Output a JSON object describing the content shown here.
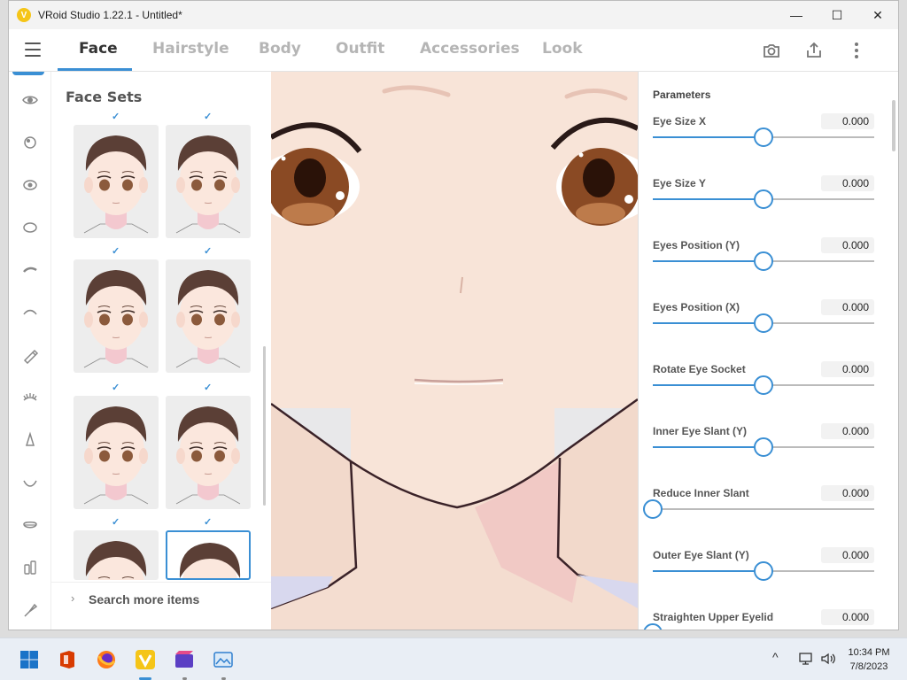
{
  "window": {
    "title": "VRoid Studio 1.22.1 - Untitled*",
    "controls": {
      "minimize": "—",
      "maximize": "☐",
      "close": "✕"
    }
  },
  "tabs": [
    {
      "label": "Face",
      "active": true
    },
    {
      "label": "Hairstyle",
      "active": false
    },
    {
      "label": "Body",
      "active": false
    },
    {
      "label": "Outfit",
      "active": false
    },
    {
      "label": "Accessories",
      "active": false
    },
    {
      "label": "Look",
      "active": false
    }
  ],
  "toolbar_icons": [
    "camera-icon",
    "export-icon",
    "more-vert-icon"
  ],
  "rail_icons": [
    "eye-icon",
    "eye-highlight-icon",
    "eye-iris-icon",
    "eye-white-icon",
    "eyebrow-icon",
    "eyelid-icon",
    "eyeliner-icon",
    "eyelash-icon",
    "nose-icon",
    "mouth-icon",
    "ear-icon",
    "teeth-icon",
    "brush-icon"
  ],
  "face_sets": {
    "title": "Face Sets",
    "check_glyph": "✓",
    "search_more": "Search more items",
    "chevron": "›"
  },
  "parameters": {
    "title": "Parameters",
    "items": [
      {
        "label": "Eye Size X",
        "value": "0.000",
        "level": 0.5
      },
      {
        "label": "Eye Size Y",
        "value": "0.000",
        "level": 0.5
      },
      {
        "label": "Eyes Position (Y)",
        "value": "0.000",
        "level": 0.5
      },
      {
        "label": "Eyes Position (X)",
        "value": "0.000",
        "level": 0.5
      },
      {
        "label": "Rotate Eye Socket",
        "value": "0.000",
        "level": 0.5
      },
      {
        "label": "Inner Eye Slant (Y)",
        "value": "0.000",
        "level": 0.5
      },
      {
        "label": "Reduce Inner Slant",
        "value": "0.000",
        "level": 0.0
      },
      {
        "label": "Outer Eye Slant (Y)",
        "value": "0.000",
        "level": 0.5
      },
      {
        "label": "Straighten Upper Eyelid",
        "value": "0.000",
        "level": 0.0
      }
    ]
  },
  "taskbar": {
    "time": "10:34 PM",
    "date": "7/8/2023",
    "chevron": "^"
  },
  "colors": {
    "accent": "#3a8fd4",
    "skin": "#f8e4d8",
    "iris": "#8a4a24"
  }
}
